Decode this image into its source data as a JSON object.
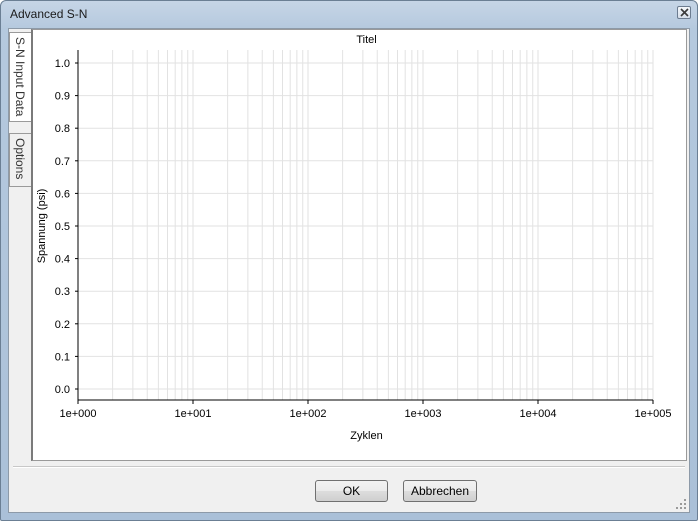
{
  "window": {
    "title": "Advanced S-N"
  },
  "tabs": [
    {
      "label": "S-N Input Data",
      "active": true
    },
    {
      "label": "Options",
      "active": false
    }
  ],
  "buttons": {
    "ok_label": "OK",
    "cancel_label": "Abbrechen"
  },
  "icons": {
    "close": "close-icon",
    "resize": "resize-grip-icon"
  },
  "colors": {
    "grid": "#e2e2e2",
    "axis": "#000000"
  },
  "chart_data": {
    "type": "line",
    "title": "Titel",
    "xlabel": "Zyklen",
    "ylabel": "Spannung (psi)",
    "x_scale": "log",
    "xlim": [
      1,
      100000
    ],
    "ylim": [
      0.0,
      1.0
    ],
    "x_ticks": [
      "1e+000",
      "1e+001",
      "1e+002",
      "1e+003",
      "1e+004",
      "1e+005"
    ],
    "y_ticks": [
      "0.0",
      "0.1",
      "0.2",
      "0.3",
      "0.4",
      "0.5",
      "0.6",
      "0.7",
      "0.8",
      "0.9",
      "1.0"
    ],
    "grid": true,
    "series": []
  }
}
